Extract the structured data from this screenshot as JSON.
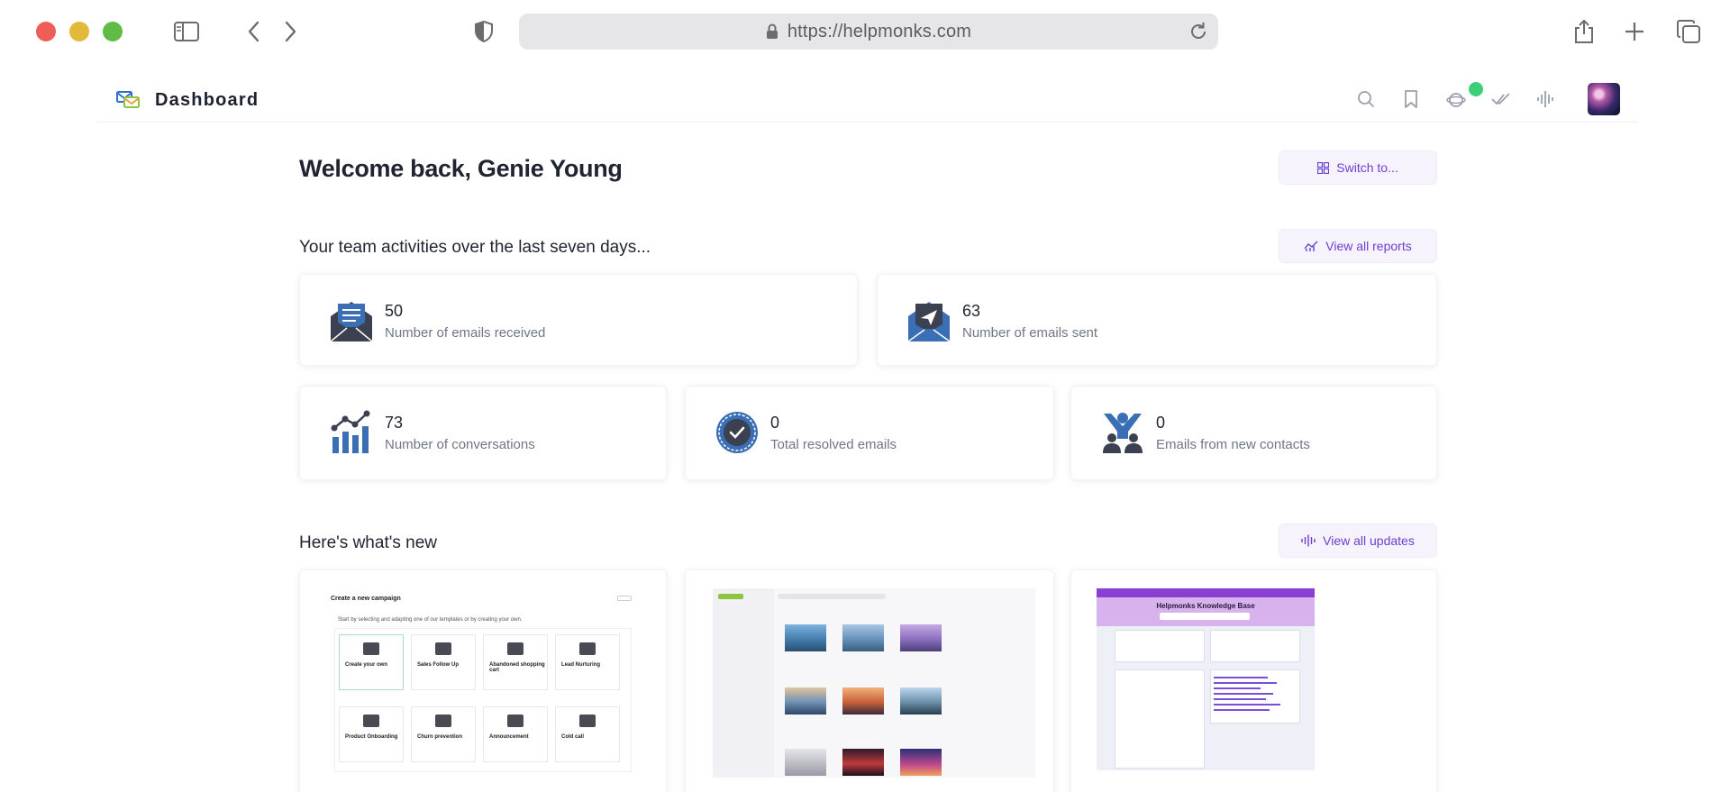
{
  "browser": {
    "url": "https://helpmonks.com"
  },
  "app": {
    "title": "Dashboard"
  },
  "welcome": {
    "heading": "Welcome back, Genie Young",
    "switch_label": "Switch to..."
  },
  "activities": {
    "heading": "Your team activities over the last seven days...",
    "reports_label": "View all reports",
    "stats": [
      {
        "value": "50",
        "label": "Number of emails received",
        "icon": "email-received-icon"
      },
      {
        "value": "63",
        "label": "Number of emails sent",
        "icon": "email-sent-icon"
      },
      {
        "value": "73",
        "label": "Number of conversations",
        "icon": "conversations-chart-icon"
      },
      {
        "value": "0",
        "label": "Total resolved emails",
        "icon": "resolved-badge-icon"
      },
      {
        "value": "0",
        "label": "Emails from new contacts",
        "icon": "new-contacts-icon"
      }
    ]
  },
  "news": {
    "heading": "Here's what's new",
    "updates_label": "View all updates",
    "campaign_preview": {
      "title": "Create a new campaign",
      "subtitle": "Start by selecting and adapting one of our templates or by creating your own.",
      "tiles": [
        "Create your own",
        "Sales Follow Up",
        "Abandoned shopping cart",
        "Lead Nurturing",
        "Product Onboarding",
        "Churn prevention",
        "Announcement",
        "Cold call"
      ]
    },
    "kb_preview": {
      "title": "Helpmonks Knowledge Base"
    }
  },
  "colors": {
    "accent": "#6b3fd1",
    "accent_bg": "#f6f3fd",
    "icon_blue": "#3a6fb5",
    "icon_dark": "#3b4150",
    "status_online": "#3ccf7a"
  }
}
